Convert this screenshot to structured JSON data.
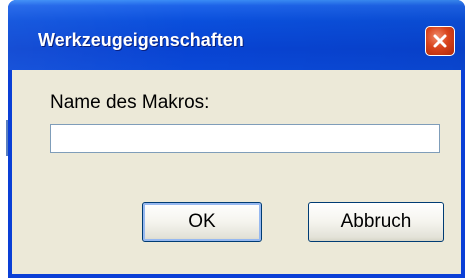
{
  "window": {
    "title": "Werkzeugeigenschaften",
    "close_icon": "close-icon"
  },
  "form": {
    "label": "Name des Makros:",
    "input_value": "",
    "input_placeholder": ""
  },
  "buttons": {
    "ok_label": "OK",
    "cancel_label": "Abbruch"
  },
  "colors": {
    "titlebar": "#0a4fdc",
    "dialog_background": "#ece9d8",
    "close_button": "#d9441c"
  }
}
